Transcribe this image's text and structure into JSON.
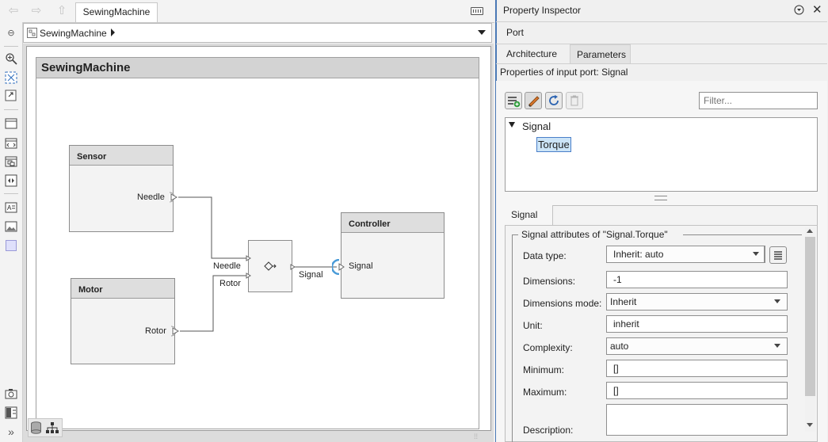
{
  "editor": {
    "tab_title": "SewingMachine",
    "breadcrumb": "SewingMachine",
    "system_title": "SewingMachine"
  },
  "diagram": {
    "blocks": [
      {
        "name": "Sensor",
        "port": "Needle"
      },
      {
        "name": "Motor",
        "port": "Rotor"
      },
      {
        "name": "Controller",
        "port": "Signal"
      }
    ],
    "mux_inputs": [
      "Needle",
      "Rotor"
    ],
    "output_line_label": "Signal"
  },
  "inspector": {
    "title": "Property Inspector",
    "section": "Port",
    "tabs": [
      "Architecture",
      "Parameters"
    ],
    "active_tab": "Parameters",
    "subtitle": "Properties of input port: Signal",
    "filter_placeholder": "Filter...",
    "tree": {
      "root": "Signal",
      "child": "Torque"
    },
    "props_tab": "Signal",
    "group_title": "Signal attributes of \"Signal.Torque\"",
    "fields": {
      "data_type": {
        "label": "Data type:",
        "value": "Inherit: auto"
      },
      "dimensions": {
        "label": "Dimensions:",
        "value": "-1"
      },
      "dimensions_mode": {
        "label": "Dimensions mode:",
        "value": "Inherit"
      },
      "unit": {
        "label": "Unit:",
        "value": "inherit"
      },
      "complexity": {
        "label": "Complexity:",
        "value": "auto"
      },
      "minimum": {
        "label": "Minimum:",
        "value": "[]"
      },
      "maximum": {
        "label": "Maximum:",
        "value": "[]"
      },
      "description": {
        "label": "Description:",
        "value": ""
      }
    }
  },
  "colors": {
    "accent": "#4a79b6",
    "selection": "#cce4f7",
    "port_highlight": "#4a9bd8"
  }
}
